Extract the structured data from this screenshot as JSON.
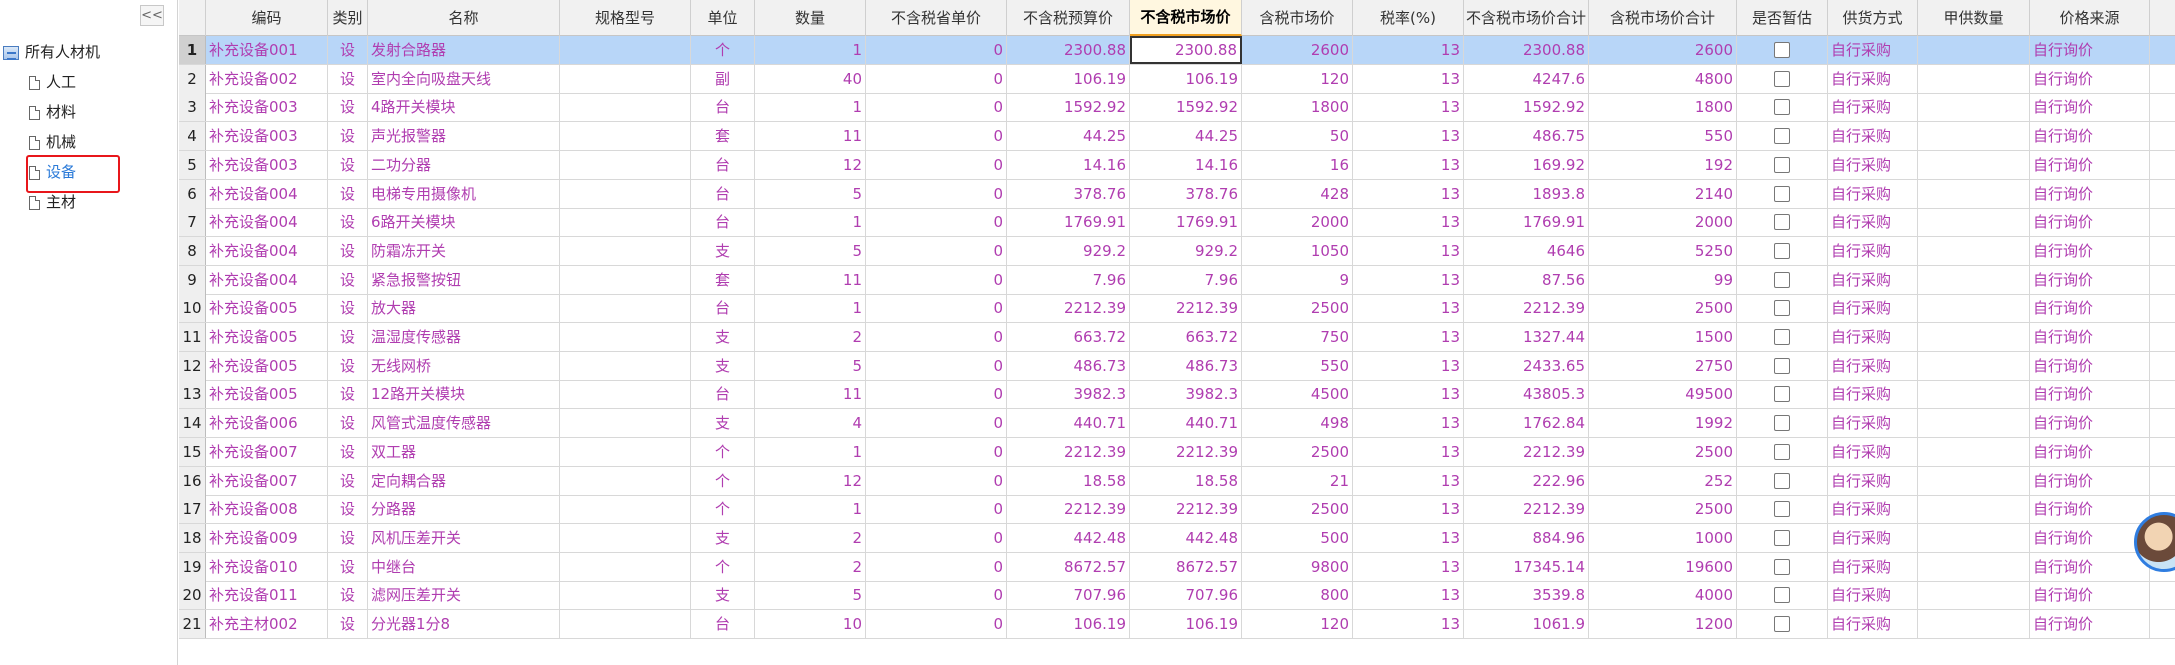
{
  "tree": {
    "collapse_label": "<<",
    "root_label": "所有人材机",
    "items": [
      {
        "label": "人工"
      },
      {
        "label": "材料"
      },
      {
        "label": "机械"
      },
      {
        "label": "设备"
      },
      {
        "label": "主材"
      }
    ],
    "selected_index": 3
  },
  "grid": {
    "columns": [
      "编码",
      "类别",
      "名称",
      "规格型号",
      "单位",
      "数量",
      "不含税省单价",
      "不含税预算价",
      "不含税市场价",
      "含税市场价",
      "税率(%)",
      "不含税市场价合计",
      "含税市场价合计",
      "是否暂估",
      "供货方式",
      "甲供数量",
      "价格来源"
    ],
    "active_column": "不含税市场价",
    "rows": [
      {
        "idx": "1",
        "code": "补充设备001",
        "type": "设",
        "name": "发射合路器",
        "spec": "",
        "unit": "个",
        "qty": "1",
        "prov": "0",
        "budget": "2300.88",
        "market": "2300.88",
        "market_tax": "2600",
        "rate": "13",
        "total": "2300.88",
        "total_tax": "2600",
        "supply": "自行采购",
        "jia": "",
        "source": "自行询价"
      },
      {
        "idx": "2",
        "code": "补充设备002",
        "type": "设",
        "name": "室内全向吸盘天线",
        "spec": "",
        "unit": "副",
        "qty": "40",
        "prov": "0",
        "budget": "106.19",
        "market": "106.19",
        "market_tax": "120",
        "rate": "13",
        "total": "4247.6",
        "total_tax": "4800",
        "supply": "自行采购",
        "jia": "",
        "source": "自行询价"
      },
      {
        "idx": "3",
        "code": "补充设备003",
        "type": "设",
        "name": "4路开关模块",
        "spec": "",
        "unit": "台",
        "qty": "1",
        "prov": "0",
        "budget": "1592.92",
        "market": "1592.92",
        "market_tax": "1800",
        "rate": "13",
        "total": "1592.92",
        "total_tax": "1800",
        "supply": "自行采购",
        "jia": "",
        "source": "自行询价"
      },
      {
        "idx": "4",
        "code": "补充设备003",
        "type": "设",
        "name": "声光报警器",
        "spec": "",
        "unit": "套",
        "qty": "11",
        "prov": "0",
        "budget": "44.25",
        "market": "44.25",
        "market_tax": "50",
        "rate": "13",
        "total": "486.75",
        "total_tax": "550",
        "supply": "自行采购",
        "jia": "",
        "source": "自行询价"
      },
      {
        "idx": "5",
        "code": "补充设备003",
        "type": "设",
        "name": "二功分器",
        "spec": "",
        "unit": "台",
        "qty": "12",
        "prov": "0",
        "budget": "14.16",
        "market": "14.16",
        "market_tax": "16",
        "rate": "13",
        "total": "169.92",
        "total_tax": "192",
        "supply": "自行采购",
        "jia": "",
        "source": "自行询价"
      },
      {
        "idx": "6",
        "code": "补充设备004",
        "type": "设",
        "name": "电梯专用摄像机",
        "spec": "",
        "unit": "台",
        "qty": "5",
        "prov": "0",
        "budget": "378.76",
        "market": "378.76",
        "market_tax": "428",
        "rate": "13",
        "total": "1893.8",
        "total_tax": "2140",
        "supply": "自行采购",
        "jia": "",
        "source": "自行询价"
      },
      {
        "idx": "7",
        "code": "补充设备004",
        "type": "设",
        "name": "6路开关模块",
        "spec": "",
        "unit": "台",
        "qty": "1",
        "prov": "0",
        "budget": "1769.91",
        "market": "1769.91",
        "market_tax": "2000",
        "rate": "13",
        "total": "1769.91",
        "total_tax": "2000",
        "supply": "自行采购",
        "jia": "",
        "source": "自行询价"
      },
      {
        "idx": "8",
        "code": "补充设备004",
        "type": "设",
        "name": "防霜冻开关",
        "spec": "",
        "unit": "支",
        "qty": "5",
        "prov": "0",
        "budget": "929.2",
        "market": "929.2",
        "market_tax": "1050",
        "rate": "13",
        "total": "4646",
        "total_tax": "5250",
        "supply": "自行采购",
        "jia": "",
        "source": "自行询价"
      },
      {
        "idx": "9",
        "code": "补充设备004",
        "type": "设",
        "name": "紧急报警按钮",
        "spec": "",
        "unit": "套",
        "qty": "11",
        "prov": "0",
        "budget": "7.96",
        "market": "7.96",
        "market_tax": "9",
        "rate": "13",
        "total": "87.56",
        "total_tax": "99",
        "supply": "自行采购",
        "jia": "",
        "source": "自行询价"
      },
      {
        "idx": "10",
        "code": "补充设备005",
        "type": "设",
        "name": "放大器",
        "spec": "",
        "unit": "台",
        "qty": "1",
        "prov": "0",
        "budget": "2212.39",
        "market": "2212.39",
        "market_tax": "2500",
        "rate": "13",
        "total": "2212.39",
        "total_tax": "2500",
        "supply": "自行采购",
        "jia": "",
        "source": "自行询价"
      },
      {
        "idx": "11",
        "code": "补充设备005",
        "type": "设",
        "name": "温湿度传感器",
        "spec": "",
        "unit": "支",
        "qty": "2",
        "prov": "0",
        "budget": "663.72",
        "market": "663.72",
        "market_tax": "750",
        "rate": "13",
        "total": "1327.44",
        "total_tax": "1500",
        "supply": "自行采购",
        "jia": "",
        "source": "自行询价"
      },
      {
        "idx": "12",
        "code": "补充设备005",
        "type": "设",
        "name": "无线网桥",
        "spec": "",
        "unit": "支",
        "qty": "5",
        "prov": "0",
        "budget": "486.73",
        "market": "486.73",
        "market_tax": "550",
        "rate": "13",
        "total": "2433.65",
        "total_tax": "2750",
        "supply": "自行采购",
        "jia": "",
        "source": "自行询价"
      },
      {
        "idx": "13",
        "code": "补充设备005",
        "type": "设",
        "name": "12路开关模块",
        "spec": "",
        "unit": "台",
        "qty": "11",
        "prov": "0",
        "budget": "3982.3",
        "market": "3982.3",
        "market_tax": "4500",
        "rate": "13",
        "total": "43805.3",
        "total_tax": "49500",
        "supply": "自行采购",
        "jia": "",
        "source": "自行询价"
      },
      {
        "idx": "14",
        "code": "补充设备006",
        "type": "设",
        "name": "风管式温度传感器",
        "spec": "",
        "unit": "支",
        "qty": "4",
        "prov": "0",
        "budget": "440.71",
        "market": "440.71",
        "market_tax": "498",
        "rate": "13",
        "total": "1762.84",
        "total_tax": "1992",
        "supply": "自行采购",
        "jia": "",
        "source": "自行询价"
      },
      {
        "idx": "15",
        "code": "补充设备007",
        "type": "设",
        "name": "双工器",
        "spec": "",
        "unit": "个",
        "qty": "1",
        "prov": "0",
        "budget": "2212.39",
        "market": "2212.39",
        "market_tax": "2500",
        "rate": "13",
        "total": "2212.39",
        "total_tax": "2500",
        "supply": "自行采购",
        "jia": "",
        "source": "自行询价"
      },
      {
        "idx": "16",
        "code": "补充设备007",
        "type": "设",
        "name": "定向耦合器",
        "spec": "",
        "unit": "个",
        "qty": "12",
        "prov": "0",
        "budget": "18.58",
        "market": "18.58",
        "market_tax": "21",
        "rate": "13",
        "total": "222.96",
        "total_tax": "252",
        "supply": "自行采购",
        "jia": "",
        "source": "自行询价"
      },
      {
        "idx": "17",
        "code": "补充设备008",
        "type": "设",
        "name": "分路器",
        "spec": "",
        "unit": "个",
        "qty": "1",
        "prov": "0",
        "budget": "2212.39",
        "market": "2212.39",
        "market_tax": "2500",
        "rate": "13",
        "total": "2212.39",
        "total_tax": "2500",
        "supply": "自行采购",
        "jia": "",
        "source": "自行询价"
      },
      {
        "idx": "18",
        "code": "补充设备009",
        "type": "设",
        "name": "风机压差开关",
        "spec": "",
        "unit": "支",
        "qty": "2",
        "prov": "0",
        "budget": "442.48",
        "market": "442.48",
        "market_tax": "500",
        "rate": "13",
        "total": "884.96",
        "total_tax": "1000",
        "supply": "自行采购",
        "jia": "",
        "source": "自行询价"
      },
      {
        "idx": "19",
        "code": "补充设备010",
        "type": "设",
        "name": "中继台",
        "spec": "",
        "unit": "个",
        "qty": "2",
        "prov": "0",
        "budget": "8672.57",
        "market": "8672.57",
        "market_tax": "9800",
        "rate": "13",
        "total": "17345.14",
        "total_tax": "19600",
        "supply": "自行采购",
        "jia": "",
        "source": "自行询价"
      },
      {
        "idx": "20",
        "code": "补充设备011",
        "type": "设",
        "name": "滤网压差开关",
        "spec": "",
        "unit": "支",
        "qty": "5",
        "prov": "0",
        "budget": "707.96",
        "market": "707.96",
        "market_tax": "800",
        "rate": "13",
        "total": "3539.8",
        "total_tax": "4000",
        "supply": "自行采购",
        "jia": "",
        "source": "自行询价"
      },
      {
        "idx": "21",
        "code": "补充主材002",
        "type": "设",
        "name": "分光器1分8",
        "spec": "",
        "unit": "台",
        "qty": "10",
        "prov": "0",
        "budget": "106.19",
        "market": "106.19",
        "market_tax": "120",
        "rate": "13",
        "total": "1061.9",
        "total_tax": "1200",
        "supply": "自行采购",
        "jia": "",
        "source": "自行询价"
      }
    ],
    "selected_row": 0
  },
  "colors": {
    "accent_text": "#b03db0",
    "selected_row": "#b8d6f8",
    "tree_selected": "#2a7ad8",
    "highlight_box": "#e8161b"
  },
  "icons": [
    "collapse-icon",
    "tree-root-icon",
    "document-icon",
    "checkbox",
    "avatar"
  ]
}
